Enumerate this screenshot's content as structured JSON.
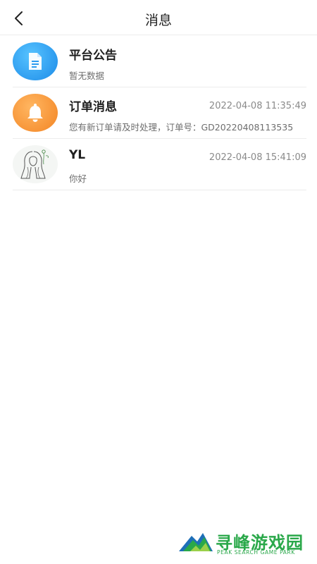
{
  "header": {
    "title": "消息"
  },
  "messages": [
    {
      "name": "平台公告",
      "time": "",
      "preview": "暂无数据",
      "avatar_icon": "document-icon",
      "avatar_color": "#2d9cf0"
    },
    {
      "name": "订单消息",
      "time": "2022-04-08 11:35:49",
      "preview": "您有新订单请及时处理，订单号：GD20220408113535",
      "avatar_icon": "bell-icon",
      "avatar_color": "#f7962f"
    },
    {
      "name": "YL",
      "time": "2022-04-08 15:41:09",
      "preview": "你好",
      "avatar_icon": "user-avatar-sketch"
    }
  ],
  "watermark": {
    "name": "寻峰游戏园",
    "subtitle": "PEAK SEARCH GAME PARK",
    "color": "#2aa84a"
  }
}
